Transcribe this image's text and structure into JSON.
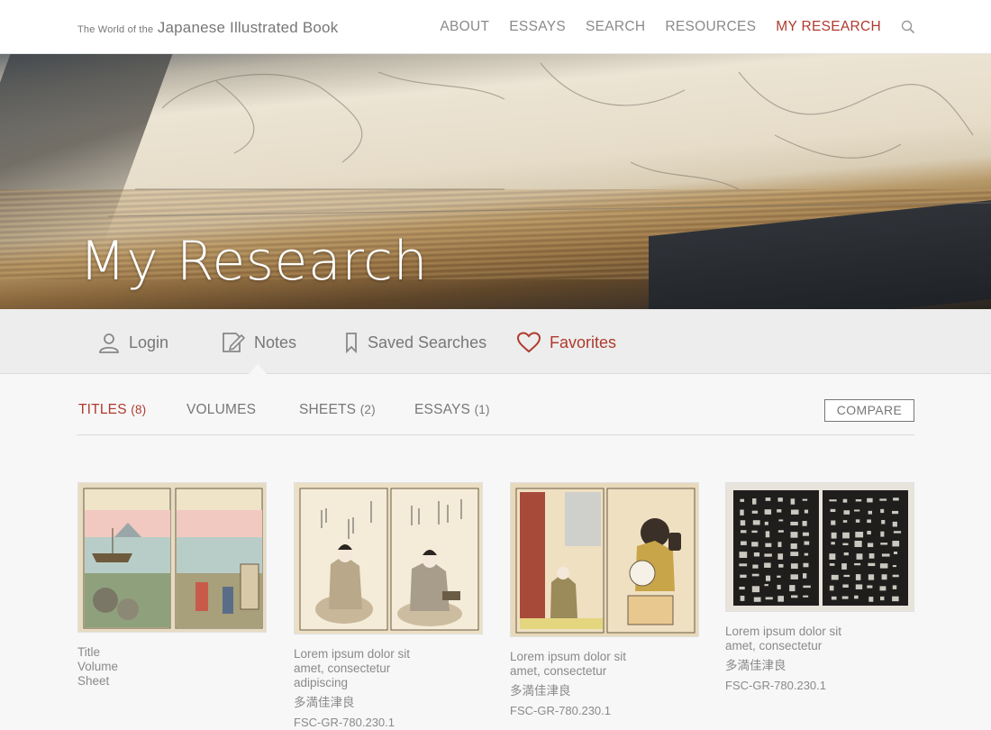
{
  "site": {
    "title_small": "The World of the",
    "title_big": "Japanese Illustrated Book"
  },
  "nav": {
    "items": [
      "ABOUT",
      "ESSAYS",
      "SEARCH",
      "RESOURCES",
      "MY RESEARCH"
    ],
    "active": "MY RESEARCH",
    "search_icon": "search-icon"
  },
  "hero": {
    "title": "My Research"
  },
  "research_tabs": [
    {
      "label": "Login",
      "icon": "user-icon"
    },
    {
      "label": "Notes",
      "icon": "notes-edit-icon"
    },
    {
      "label": "Saved Searches",
      "icon": "bookmark-icon"
    },
    {
      "label": "Favorites",
      "icon": "heart-icon",
      "active": true
    }
  ],
  "sub_tabs": [
    {
      "label": "TITLES",
      "count": "(8)",
      "active": true
    },
    {
      "label": "VOLUMES",
      "count": ""
    },
    {
      "label": "SHEETS",
      "count": "(2)"
    },
    {
      "label": "ESSAYS",
      "count": "(1)"
    }
  ],
  "compare_label": "COMPARE",
  "cards": [
    {
      "lines": [
        "Title",
        "Volume",
        "Sheet"
      ],
      "japanese": "",
      "id": ""
    },
    {
      "lines": [
        "Lorem ipsum dolor sit",
        "amet, consectetur",
        "adipiscing"
      ],
      "japanese": "多満佳津良",
      "id": "FSC-GR-780.230.1"
    },
    {
      "lines": [
        "Lorem ipsum dolor sit",
        "amet, consectetur"
      ],
      "japanese": "多満佳津良",
      "id": "FSC-GR-780.230.1"
    },
    {
      "lines": [
        "Lorem ipsum dolor sit",
        "amet, consectetur"
      ],
      "japanese": "多満佳津良",
      "id": "FSC-GR-780.230.1"
    }
  ],
  "colors": {
    "accent": "#b03a2e",
    "text": "#777777",
    "background": "#f7f7f7"
  }
}
